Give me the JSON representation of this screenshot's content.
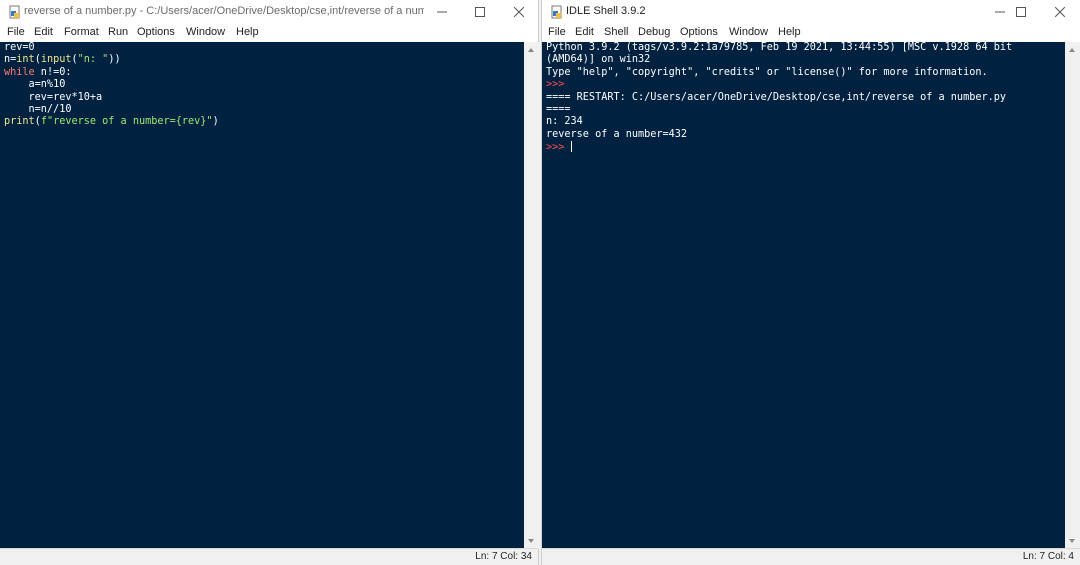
{
  "editor_window": {
    "title": "reverse of a number.py - C:/Users/acer/OneDrive/Desktop/cse,int/reverse of a number....",
    "menu": [
      "File",
      "Edit",
      "Format",
      "Run",
      "Options",
      "Window",
      "Help"
    ],
    "code": {
      "line1": "rev=0",
      "line2_a": "n=",
      "line2_int": "int",
      "line2_b": "(",
      "line2_input": "input",
      "line2_c": "(",
      "line2_str": "\"n: \"",
      "line2_d": "))",
      "line3_kw": "while",
      "line3_b": " n!=0:",
      "line4": "    a=n%10",
      "line5": "    rev=rev*10+a",
      "line6": "    n=n//10",
      "line7_print": "print",
      "line7_b": "(",
      "line7_str": "f\"reverse of a number={rev}\"",
      "line7_c": ")"
    },
    "status": "Ln: 7   Col: 34"
  },
  "shell_window": {
    "title": "IDLE Shell 3.9.2",
    "menu": [
      "File",
      "Edit",
      "Shell",
      "Debug",
      "Options",
      "Window",
      "Help"
    ],
    "output": {
      "line1": "Python 3.9.2 (tags/v3.9.2:1a79785, Feb 19 2021, 13:44:55) [MSC v.1928 64 bit",
      "line2": "(AMD64)] on win32",
      "line3": "Type \"help\", \"copyright\", \"credits\" or \"license()\" for more information.",
      "prompt": ">>>",
      "line5": "==== RESTART: C:/Users/acer/OneDrive/Desktop/cse,int/reverse of a number.py",
      "line6": "====",
      "line7": "n: 234",
      "line8": "reverse of a number=432"
    },
    "status": "Ln: 7   Col: 4"
  },
  "colors": {
    "editor_bg": "#002240",
    "keyword": "#ff7b72",
    "builtin": "#f0e68c",
    "string": "#9fe870",
    "prompt": "#ff4d4d"
  }
}
